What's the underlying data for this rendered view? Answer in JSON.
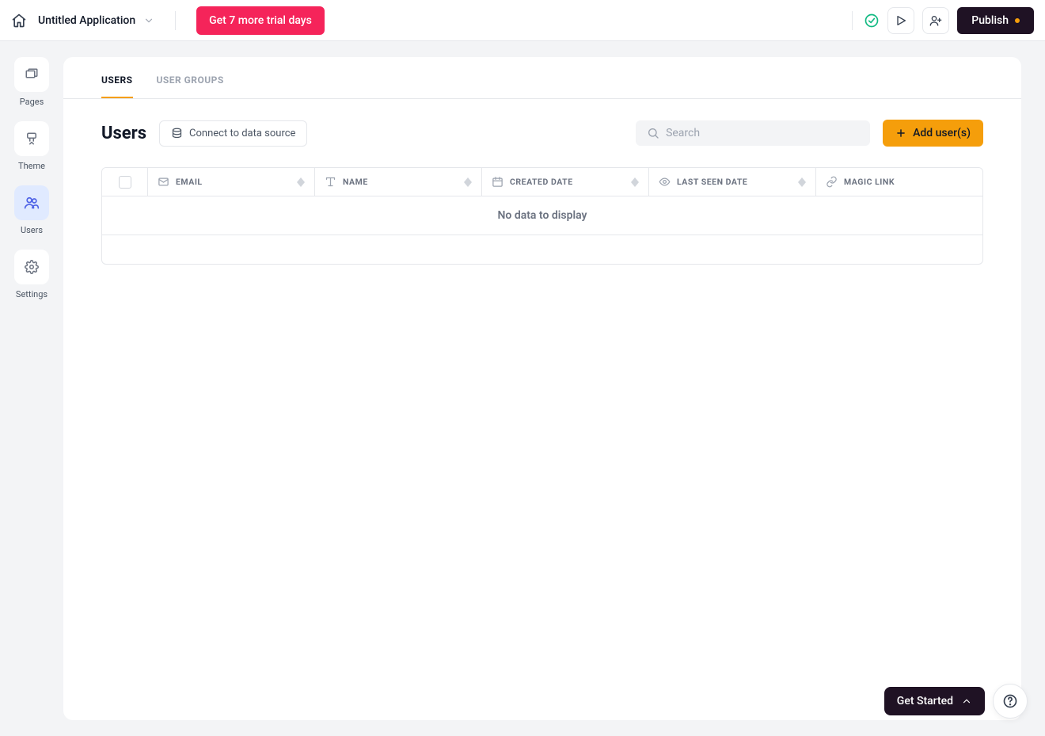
{
  "header": {
    "app_title": "Untitled Application",
    "trial_label": "Get 7 more trial days",
    "publish_label": "Publish"
  },
  "sidebar": {
    "items": [
      {
        "label": "Pages"
      },
      {
        "label": "Theme"
      },
      {
        "label": "Users"
      },
      {
        "label": "Settings"
      }
    ]
  },
  "tabs": {
    "users": "USERS",
    "groups": "USER GROUPS"
  },
  "toolbar": {
    "title": "Users",
    "connect_label": "Connect to data source",
    "search_placeholder": "Search",
    "add_user_label": "Add user(s)"
  },
  "table": {
    "columns": {
      "email": "EMAIL",
      "name": "NAME",
      "created": "CREATED DATE",
      "seen": "LAST SEEN DATE",
      "magic": "MAGIC LINK"
    },
    "empty_message": "No data to display",
    "rows": []
  },
  "float": {
    "get_started": "Get Started"
  }
}
